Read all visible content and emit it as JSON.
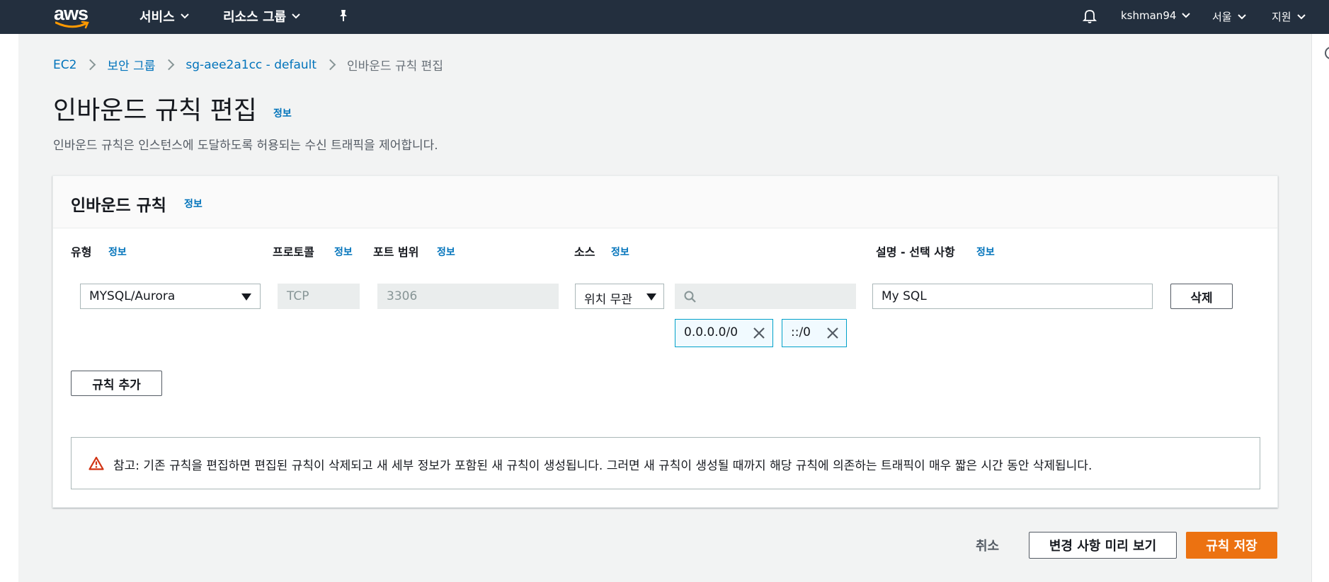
{
  "topnav": {
    "logo_text": "aws",
    "services": "서비스",
    "resource_groups": "리소스 그룹",
    "user": "kshman94",
    "region": "서울",
    "support": "지원",
    "icons": [
      "pin-icon",
      "bell-icon"
    ]
  },
  "breadcrumb": {
    "items": [
      "EC2",
      "보안 그룹",
      "sg-aee2a1cc - default",
      "인바운드 규칙 편집"
    ]
  },
  "page": {
    "title": "인바운드 규칙 편집",
    "info": "정보",
    "description": "인바운드 규칙은 인스턴스에 도달하도록 허용되는 수신 트래픽을 제어합니다."
  },
  "panel": {
    "title": "인바운드 규칙",
    "info": "정보",
    "columns": {
      "type": "유형",
      "protocol": "프로토콜",
      "port_range": "포트 범위",
      "source": "소스",
      "description": "설명 - 선택 사항"
    },
    "rule": {
      "type": "MYSQL/Aurora",
      "protocol": "TCP",
      "port_range": "3306",
      "source_mode": "위치 무관",
      "source_search": "",
      "description": "My SQL",
      "delete_label": "삭제",
      "cidrs": [
        "0.0.0.0/0",
        "::/0"
      ]
    },
    "add_rule_label": "규칙 추가",
    "notice": "참고: 기존 규칙을 편집하면 편집된 규칙이 삭제되고 새 세부 정보가 포함된 새 규칙이 생성됩니다. 그러면 새 규칙이 생성될 때까지 해당 규칙에 의존하는 트래픽이 매우 짧은 시간 동안 삭제됩니다."
  },
  "footer": {
    "cancel": "취소",
    "preview": "변경 사항 미리 보기",
    "save": "규칙 저장"
  },
  "colors": {
    "nav_bg": "#232f3e",
    "link": "#0073bb",
    "primary": "#ec7211",
    "token_border": "#00a1c9",
    "warning": "#d13212"
  }
}
